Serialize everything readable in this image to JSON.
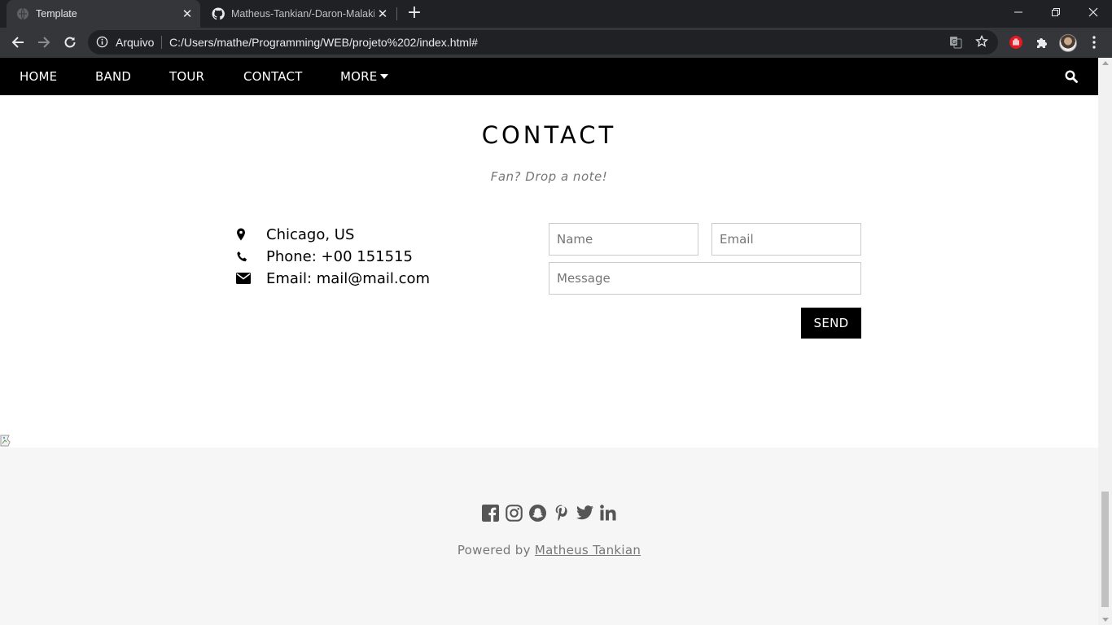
{
  "browser": {
    "tabs": [
      {
        "title": "Template",
        "active": true
      },
      {
        "title": "Matheus-Tankian/-Daron-Malakian",
        "active": false
      }
    ],
    "new_tab_label": "+",
    "address_chip": "Arquivo",
    "url": "C:/Users/mathe/Programming/WEB/projeto%202/index.html#"
  },
  "nav": {
    "items": [
      "HOME",
      "BAND",
      "TOUR",
      "CONTACT",
      "MORE"
    ]
  },
  "contact": {
    "title": "CONTACT",
    "subtitle": "Fan? Drop a note!",
    "location": "Chicago, US",
    "phone": "Phone: +00 151515",
    "email": "Email: mail@mail.com",
    "form": {
      "name_placeholder": "Name",
      "email_placeholder": "Email",
      "message_placeholder": "Message",
      "send_label": "SEND"
    }
  },
  "footer": {
    "social_icons": [
      "facebook-icon",
      "instagram-icon",
      "snapchat-icon",
      "pinterest-icon",
      "twitter-icon",
      "linkedin-icon"
    ],
    "powered_prefix": "Powered by",
    "powered_link": "Matheus Tankian"
  },
  "colors": {
    "browser_frame": "#202124",
    "toolbar": "#35363a",
    "navbar": "#000000",
    "footer_bg": "#f6f6f6",
    "muted_text": "#777777"
  }
}
